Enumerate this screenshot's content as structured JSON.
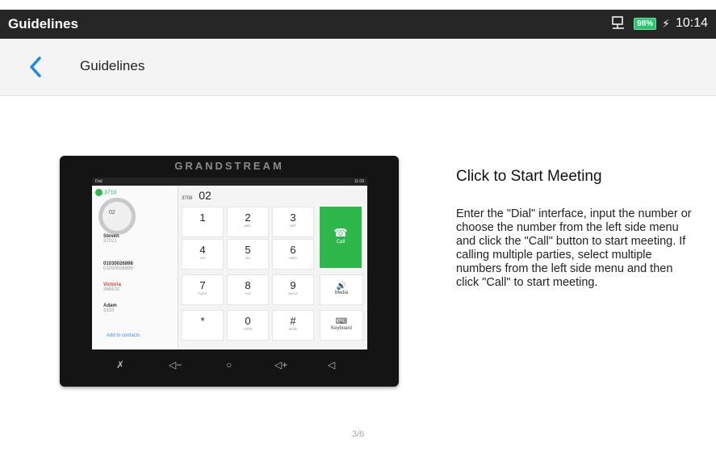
{
  "status_bar": {
    "title": "Guidelines",
    "battery": "98%",
    "time": "10:14",
    "network_icon": "ethernet-icon",
    "charging_icon": "bolt-icon"
  },
  "appbar": {
    "back_icon": "chevron-left-icon",
    "title": "Guidelines"
  },
  "device": {
    "brand": "GRANDSTREAM",
    "status_left": "Dial",
    "status_time": "11:09",
    "account": "3710",
    "ring_value": "02",
    "contacts": [
      {
        "name": "Steven",
        "number": "37021"
      },
      {
        "name": "01030026898",
        "number": "01030026898"
      },
      {
        "name": "Victoria",
        "number": "366102"
      },
      {
        "name": "Adam",
        "number": "3333"
      }
    ],
    "add_contacts": "Add to contacts",
    "display_account": "3708",
    "display_number": "02",
    "keys": [
      {
        "d": "1",
        "s": ""
      },
      {
        "d": "2",
        "s": "ABC"
      },
      {
        "d": "3",
        "s": "DEF"
      },
      {
        "d": "4",
        "s": "GHI"
      },
      {
        "d": "5",
        "s": "JKL"
      },
      {
        "d": "6",
        "s": "MNO"
      },
      {
        "d": "7",
        "s": "PQRS"
      },
      {
        "d": "8",
        "s": "TUV"
      },
      {
        "d": "9",
        "s": "WXYZ"
      },
      {
        "d": "*",
        "s": ""
      },
      {
        "d": "0",
        "s": "OPER"
      },
      {
        "d": "#",
        "s": "SEND"
      }
    ],
    "call_label": "Call",
    "media_label": "Media",
    "keyboard_label": "Keyboard"
  },
  "content": {
    "heading": "Click to Start Meeting",
    "body": "Enter the \"Dial\" interface, input the number or choose the number from the left side menu and click the \"Call\" button to start meeting. If calling multiple parties, select multiple numbers from the left side menu and then click \"Call\" to start meeting."
  },
  "pager": "3/6",
  "colors": {
    "status_bar": "#262626",
    "accent": "#1e88e5",
    "call_green": "#2eb84c"
  }
}
